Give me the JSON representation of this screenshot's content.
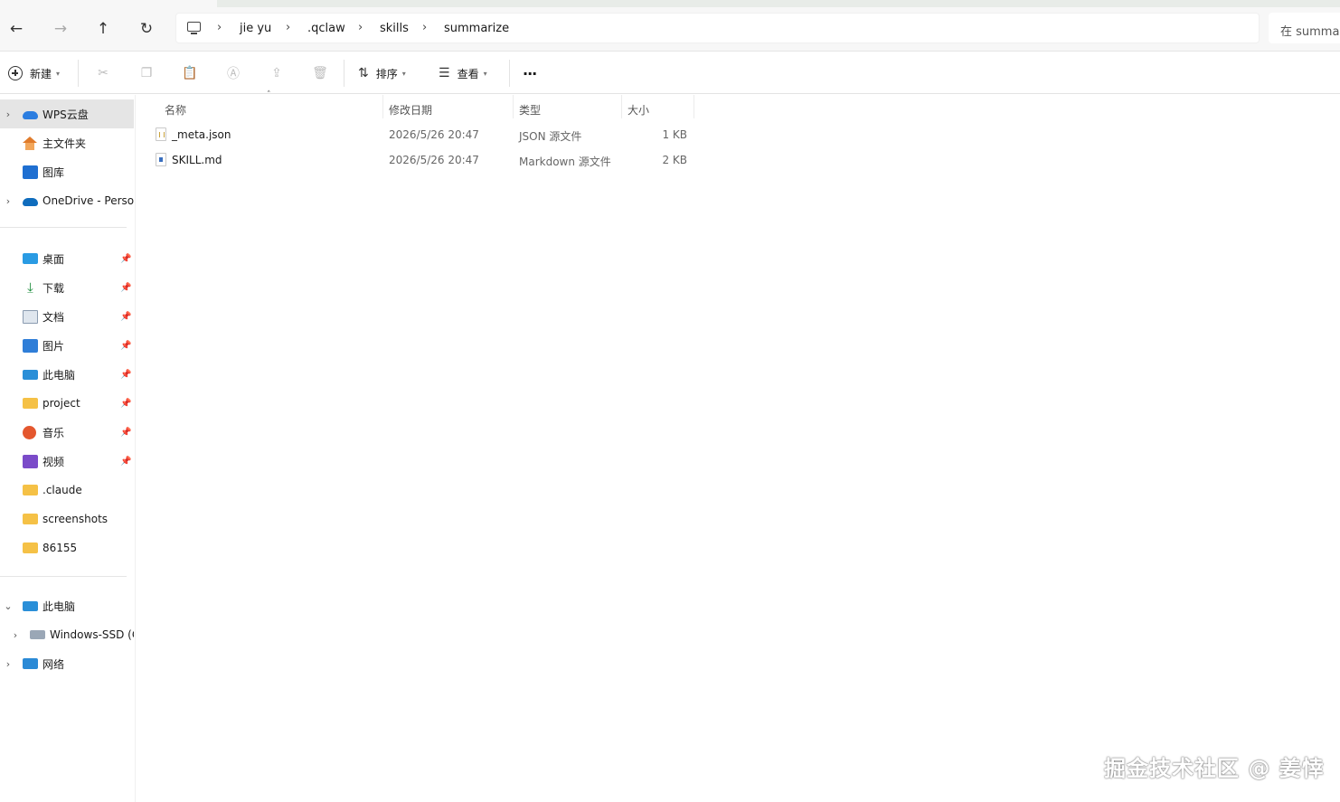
{
  "address_bar": {
    "crumbs": [
      "jie yu",
      ".qclaw",
      "skills",
      "summarize"
    ],
    "search_placeholder": "在 summar"
  },
  "toolbar": {
    "new_label": "新建",
    "sort_label": "排序",
    "view_label": "查看",
    "more_label": "···"
  },
  "sidebar": {
    "top_items": [
      {
        "label": "WPS云盘",
        "icon": "cloud-icon",
        "expandable": true,
        "selected": true
      },
      {
        "label": "主文件夹",
        "icon": "home-icon",
        "expandable": false
      },
      {
        "label": "图库",
        "icon": "gallery-icon",
        "expandable": false
      },
      {
        "label": "OneDrive - Perso",
        "icon": "onedrive-icon",
        "expandable": true
      }
    ],
    "quick_access": [
      {
        "label": "桌面",
        "icon": "desktop-icon",
        "pinned": true
      },
      {
        "label": "下载",
        "icon": "download-icon",
        "pinned": true
      },
      {
        "label": "文档",
        "icon": "documents-icon",
        "pinned": true
      },
      {
        "label": "图片",
        "icon": "pictures-icon",
        "pinned": true
      },
      {
        "label": "此电脑",
        "icon": "this-pc-icon",
        "pinned": true
      },
      {
        "label": "project",
        "icon": "folder-icon",
        "pinned": true
      },
      {
        "label": "音乐",
        "icon": "music-icon",
        "pinned": true
      },
      {
        "label": "视频",
        "icon": "video-icon",
        "pinned": true
      },
      {
        "label": ".claude",
        "icon": "folder-icon",
        "pinned": false
      },
      {
        "label": "screenshots",
        "icon": "folder-icon",
        "pinned": false
      },
      {
        "label": "86155",
        "icon": "folder-icon",
        "pinned": false
      }
    ],
    "devices": [
      {
        "label": "此电脑",
        "icon": "this-pc-icon",
        "chevron": "expanded"
      },
      {
        "label": "Windows-SSD (C",
        "icon": "drive-icon",
        "chevron": "collapsed"
      },
      {
        "label": "网络",
        "icon": "network-icon",
        "chevron": "collapsed"
      }
    ]
  },
  "columns": {
    "name": "名称",
    "date": "修改日期",
    "type": "类型",
    "size": "大小"
  },
  "files": [
    {
      "name": "_meta.json",
      "date": "2026/5/26 20:47",
      "type": "JSON 源文件",
      "size": "1 KB",
      "icon": "json-file-icon"
    },
    {
      "name": "SKILL.md",
      "date": "2026/5/26 20:47",
      "type": "Markdown 源文件",
      "size": "2 KB",
      "icon": "markdown-file-icon"
    }
  ],
  "watermark": "掘金技术社区 @ 姜悻"
}
